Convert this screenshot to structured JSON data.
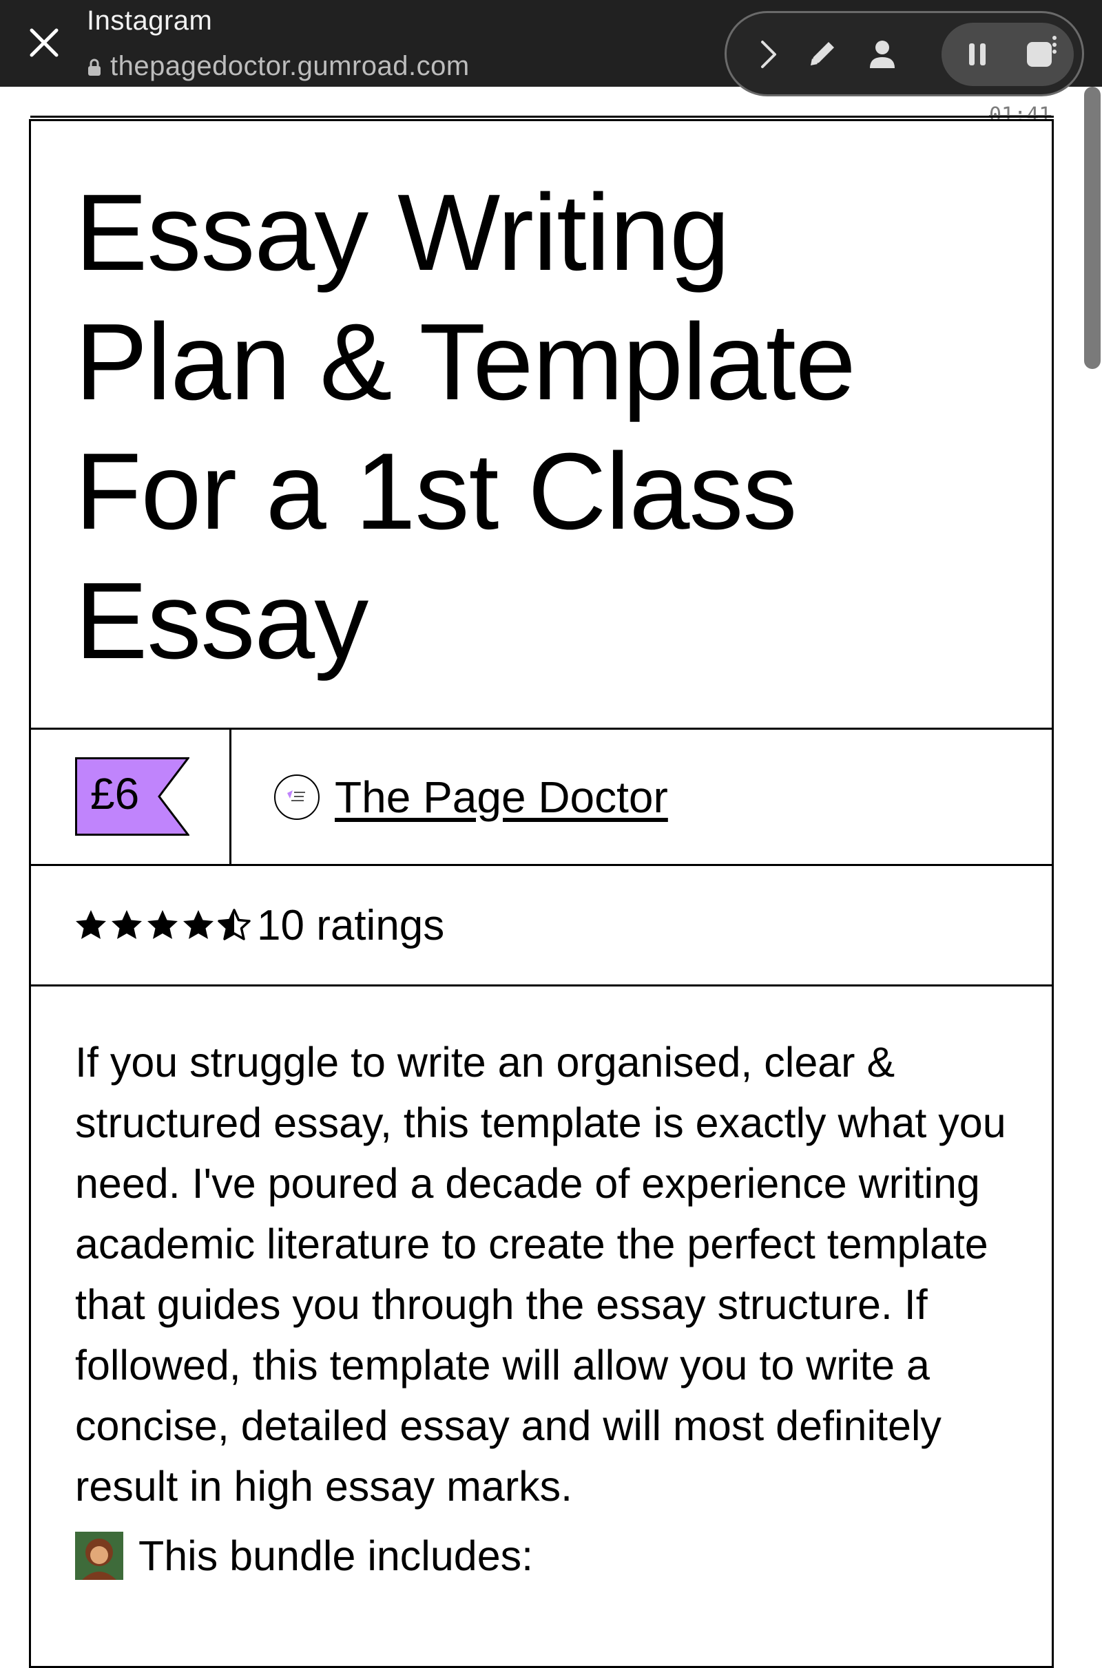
{
  "browser": {
    "app_name": "Instagram",
    "url": "thepagedoctor.gumroad.com"
  },
  "recorder": {
    "timer": "01:41"
  },
  "product": {
    "title_lines": [
      "Essay Writing",
      "Plan & Template",
      "For a 1st Class",
      "Essay"
    ],
    "price": "£6",
    "price_tag_color": "#c084fc",
    "creator": "The Page Doctor",
    "rating_stars": 4.5,
    "rating_text": "10 ratings",
    "description": "If you struggle to write an organised, clear & structured essay, this template is exactly what you need. I've poured a decade of experience writing academic literature to create the perfect template that guides you through the essay structure. If followed, this template will allow you to write a concise, detailed essay and will most definitely result in high essay marks.",
    "bundle_intro": "This bundle includes:"
  }
}
